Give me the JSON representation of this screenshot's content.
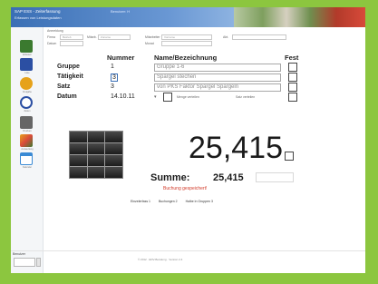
{
  "window": {
    "title": "SAP ESS - Zeiterfassung",
    "subtitle": "Erfassen von Leistungsdaten",
    "user": "Benutzer: H"
  },
  "sidebar": {
    "items": [
      {
        "label": "Erfassen",
        "icon": "home-icon",
        "color": "#3b7a2f"
      },
      {
        "label": "Liste",
        "icon": "grid-icon",
        "color": "#2b4fa3"
      },
      {
        "label": "Freigabe",
        "icon": "circle-check-icon",
        "color": "#e6a21a"
      },
      {
        "label": "Zeiten",
        "icon": "clock-icon",
        "color": "#2b4fa3"
      },
      {
        "label": "Drucken",
        "icon": "print-icon",
        "color": "#555555"
      },
      {
        "label": "Auswertung",
        "icon": "chart-icon",
        "color": "#d94a3a"
      },
      {
        "label": "Kalender",
        "icon": "calendar-icon",
        "color": "#3a8ad4"
      }
    ],
    "bottom_label": "Benutzer"
  },
  "top_fields": {
    "title": "Anmeldung",
    "row1": [
      {
        "label": "Firma",
        "value": "Betrieb"
      },
      {
        "label": "Mitarb.",
        "value": "Zuname"
      },
      {
        "label": "Mitarbeiter",
        "value": "Vorname"
      },
      {
        "label": "Abt.",
        "value": ""
      }
    ],
    "row2": [
      {
        "label": "Datum",
        "value": ""
      },
      {
        "label": "Monat",
        "value": ""
      }
    ]
  },
  "table": {
    "headers": [
      "Nummer",
      "Name/Bezeichnung",
      "Fest"
    ],
    "rows": [
      {
        "label": "Gruppe",
        "number": "1",
        "name": "Gruppe 1-6"
      },
      {
        "label": "Tätigkeit",
        "number": "3",
        "name": "Spargel stechen"
      },
      {
        "label": "Satz",
        "number": "3",
        "name": "von PKS Faktor Spargel Spargeln"
      },
      {
        "label": "Datum",
        "number": "14.10.11",
        "name": ""
      }
    ],
    "date_buttons": [
      "Menge verteilen",
      "Satz verteilen"
    ]
  },
  "display": {
    "value": "25,415",
    "sum_label": "Summe:",
    "sum_value": "25,415",
    "status": "Buchung gespeichert!"
  },
  "links": [
    "Einzelerfass 1",
    "Buchungen 2",
    "Halbe in Gruppen 3"
  ],
  "footer": "© 2012 · EDV-Beratung · Version 2.4"
}
